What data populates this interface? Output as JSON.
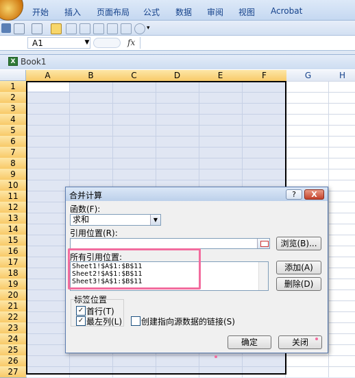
{
  "ribbon": {
    "tabs": [
      "开始",
      "插入",
      "页面布局",
      "公式",
      "数据",
      "审阅",
      "视图",
      "Acrobat"
    ]
  },
  "formula_bar": {
    "name_box": "A1",
    "fx_label": "fx"
  },
  "workbook": {
    "title": "Book1"
  },
  "grid": {
    "columns": [
      "A",
      "B",
      "C",
      "D",
      "E",
      "F",
      "G",
      "H"
    ],
    "rows": [
      "1",
      "2",
      "3",
      "4",
      "5",
      "6",
      "7",
      "8",
      "9",
      "10",
      "11",
      "12",
      "13",
      "14",
      "15",
      "16",
      "17",
      "18",
      "19",
      "20",
      "21",
      "22",
      "23",
      "24",
      "25",
      "26",
      "27"
    ]
  },
  "dialog": {
    "title": "合并计算",
    "help": "?",
    "close": "X",
    "function_label": "函数(F):",
    "function_value": "求和",
    "reference_label": "引用位置(R):",
    "reference_value": "",
    "browse_button": "浏览(B)...",
    "all_references_label": "所有引用位置:",
    "references": [
      "Sheet1!$A$1:$B$11",
      "Sheet2!$A$1:$B$11",
      "Sheet3!$A$1:$B$11"
    ],
    "add_button": "添加(A)",
    "delete_button": "删除(D)",
    "labels_group_title": "标签位置",
    "first_row_label": "首行(T)",
    "first_row_checked": true,
    "left_column_label": "最左列(L)",
    "left_column_checked": true,
    "link_label": "创建指向源数据的链接(S)",
    "link_checked": false,
    "ok_button": "确定",
    "close_button": "关闭"
  },
  "colors": {
    "highlight": "#f26c9e",
    "ribbon_text": "#15428b"
  }
}
